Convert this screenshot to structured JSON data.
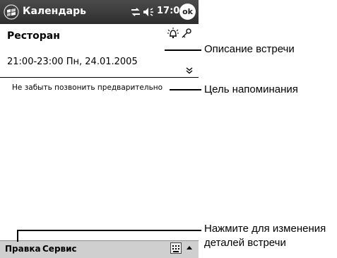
{
  "titlebar": {
    "app_title": "Календарь",
    "time": "17:00",
    "ok_label": "ok"
  },
  "appointment": {
    "title": "Ресторан",
    "datetime": "21:00-23:00 Пн, 24.01.2005",
    "notes": "Не забыть позвонить предварительно"
  },
  "menubar": {
    "items": [
      "Правка",
      "Сервис"
    ]
  },
  "callouts": {
    "description": "Описание встречи",
    "reminder": "Цель напоминания",
    "edit_line1": "Нажмите для изменения",
    "edit_line2": "деталей встречи"
  },
  "icons": [
    "windows-flag-icon",
    "connectivity-icon",
    "volume-icon",
    "alarm-icon",
    "private-key-icon",
    "expand-chevron-icon",
    "keyboard-icon",
    "arrow-up-icon"
  ]
}
